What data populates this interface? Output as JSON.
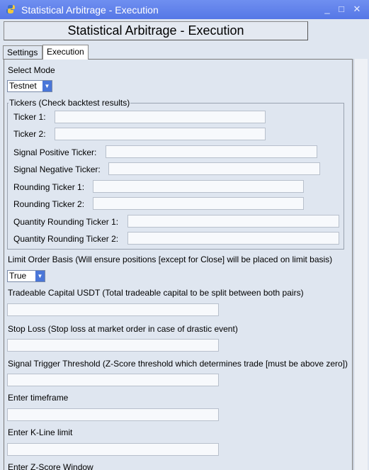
{
  "window": {
    "title": "Statistical Arbitrage - Execution",
    "icon": "python-icon",
    "controls": [
      "_",
      "□",
      "✕"
    ]
  },
  "header": {
    "title": "Statistical Arbitrage -  Execution"
  },
  "tabs": [
    {
      "label": "Settings",
      "active": false
    },
    {
      "label": "Execution",
      "active": true
    }
  ],
  "mode": {
    "label": "Select Mode",
    "value": "Testnet"
  },
  "tickers": {
    "group_title": "Tickers (Check backtest results)",
    "fields": [
      {
        "label": "Ticker 1:",
        "value": ""
      },
      {
        "label": "Ticker 2:",
        "value": ""
      },
      {
        "label": "Signal Positive Ticker:",
        "value": ""
      },
      {
        "label": "Signal Negative Ticker:",
        "value": ""
      },
      {
        "label": "Rounding Ticker 1:",
        "value": ""
      },
      {
        "label": "Rounding Ticker 2:",
        "value": ""
      },
      {
        "label": "Quantity Rounding Ticker 1:",
        "value": ""
      },
      {
        "label": "Quantity Rounding Ticker 2:",
        "value": ""
      }
    ]
  },
  "limit_order": {
    "label": "Limit Order Basis (Will ensure positions [except for Close] will be placed on limit basis)",
    "value": "True"
  },
  "settings": [
    {
      "label": "Tradeable Capital USDT (Total tradeable capital to be split between both pairs)",
      "value": ""
    },
    {
      "label": "Stop Loss (Stop loss at market order in case of drastic event)",
      "value": ""
    },
    {
      "label": "Signal Trigger Threshold (Z-Score threshold which determines trade [must be above zero])",
      "value": ""
    },
    {
      "label": "Enter timeframe",
      "value": ""
    },
    {
      "label": "Enter K-Line limit",
      "value": ""
    },
    {
      "label": "Enter Z-Score Window",
      "value": ""
    }
  ],
  "colors": {
    "titlebar": "#5a7be8",
    "dropdown_arrow": "#4a76d8",
    "background": "#dfe6f0"
  }
}
